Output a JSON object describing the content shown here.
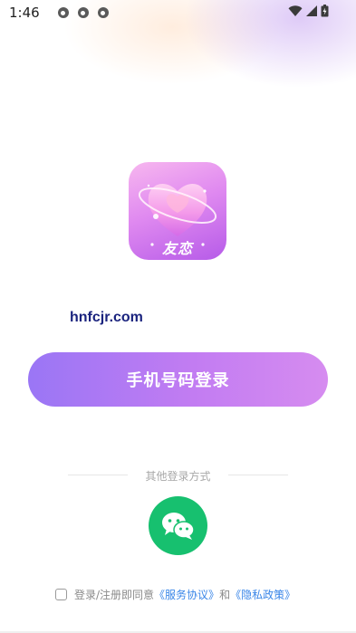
{
  "status_bar": {
    "time": "1:46",
    "notification_icons": [
      "app-notification-icon",
      "app-notification-icon",
      "app-notification-icon"
    ],
    "system_icons": [
      "wifi-icon",
      "signal-icon",
      "battery-icon"
    ]
  },
  "logo": {
    "text": "友恋",
    "icon": "heart-planet-icon"
  },
  "watermark": "hnfcjr.com",
  "login": {
    "phone_button_label": "手机号码登录",
    "other_methods_label": "其他登录方式",
    "wechat_icon": "wechat-icon"
  },
  "agreement": {
    "prefix": "登录/注册即同意",
    "service_link": "《服务协议》",
    "conjunction": "和",
    "privacy_link": "《隐私政策》",
    "checked": false
  },
  "colors": {
    "button_gradient_start": "#9a76f5",
    "button_gradient_end": "#d68cf0",
    "wechat_green": "#17c06f",
    "link_blue": "#3a86e8"
  }
}
